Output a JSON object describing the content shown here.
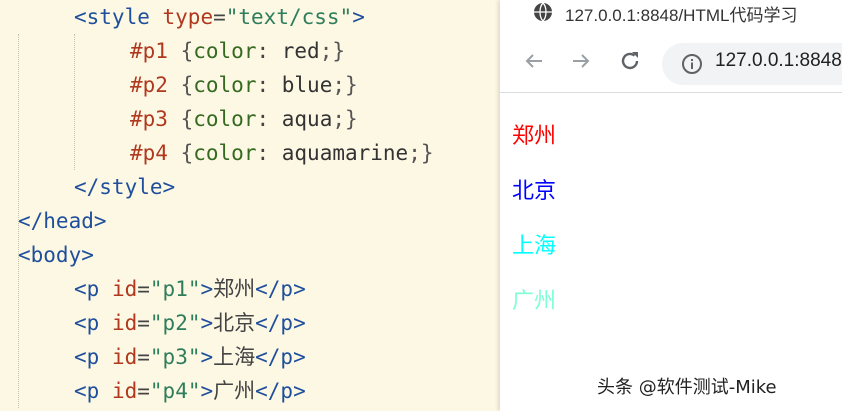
{
  "editor": {
    "lines": [
      {
        "parts": [
          [
            "tag",
            "<style"
          ],
          [
            "txt",
            " "
          ],
          [
            "attr",
            "type"
          ],
          [
            "txt",
            "="
          ],
          [
            "str",
            "\"text/css\""
          ],
          [
            "tag",
            ">"
          ]
        ]
      },
      {
        "parts": [
          [
            "sel",
            "#p1"
          ],
          [
            "txt",
            " "
          ],
          [
            "brace",
            "{"
          ],
          [
            "prop",
            "color"
          ],
          [
            "txt",
            ": "
          ],
          [
            "val",
            "red"
          ],
          [
            "brace",
            ";}"
          ]
        ]
      },
      {
        "parts": [
          [
            "sel",
            "#p2"
          ],
          [
            "txt",
            " "
          ],
          [
            "brace",
            "{"
          ],
          [
            "prop",
            "color"
          ],
          [
            "txt",
            ": "
          ],
          [
            "val",
            "blue"
          ],
          [
            "brace",
            ";}"
          ]
        ]
      },
      {
        "parts": [
          [
            "sel",
            "#p3"
          ],
          [
            "txt",
            " "
          ],
          [
            "brace",
            "{"
          ],
          [
            "prop",
            "color"
          ],
          [
            "txt",
            ": "
          ],
          [
            "val",
            "aqua"
          ],
          [
            "brace",
            ";}"
          ]
        ]
      },
      {
        "parts": [
          [
            "sel",
            "#p4"
          ],
          [
            "txt",
            " "
          ],
          [
            "brace",
            "{"
          ],
          [
            "prop",
            "color"
          ],
          [
            "txt",
            ": "
          ],
          [
            "val",
            "aquamarine"
          ],
          [
            "brace",
            ";}"
          ]
        ]
      },
      {
        "parts": [
          [
            "tag",
            "</style>"
          ]
        ]
      },
      {
        "parts": [
          [
            "tag",
            "</head>"
          ]
        ]
      },
      {
        "parts": [
          [
            "tag",
            "<body>"
          ]
        ]
      },
      {
        "parts": [
          [
            "tag",
            "<p"
          ],
          [
            "txt",
            " "
          ],
          [
            "attr",
            "id"
          ],
          [
            "txt",
            "="
          ],
          [
            "str",
            "\"p1\""
          ],
          [
            "tag",
            ">"
          ],
          [
            "txt",
            "郑州"
          ],
          [
            "tag",
            "</p>"
          ]
        ]
      },
      {
        "parts": [
          [
            "tag",
            "<p"
          ],
          [
            "txt",
            " "
          ],
          [
            "attr",
            "id"
          ],
          [
            "txt",
            "="
          ],
          [
            "str",
            "\"p2\""
          ],
          [
            "tag",
            ">"
          ],
          [
            "txt",
            "北京"
          ],
          [
            "tag",
            "</p>"
          ]
        ]
      },
      {
        "parts": [
          [
            "tag",
            "<p"
          ],
          [
            "txt",
            " "
          ],
          [
            "attr",
            "id"
          ],
          [
            "txt",
            "="
          ],
          [
            "str",
            "\"p3\""
          ],
          [
            "tag",
            ">"
          ],
          [
            "txt",
            "上海"
          ],
          [
            "tag",
            "</p>"
          ]
        ]
      },
      {
        "parts": [
          [
            "tag",
            "<p"
          ],
          [
            "txt",
            " "
          ],
          [
            "attr",
            "id"
          ],
          [
            "txt",
            "="
          ],
          [
            "str",
            "\"p4\""
          ],
          [
            "tag",
            ">"
          ],
          [
            "txt",
            "广州"
          ],
          [
            "tag",
            "</p>"
          ]
        ]
      }
    ]
  },
  "browser": {
    "tab_title": "127.0.0.1:8848/HTML代码学习",
    "url": "127.0.0.1:8848",
    "icons": {
      "tab": "globe-icon",
      "back": "back-arrow-icon",
      "forward": "forward-arrow-icon",
      "reload": "reload-icon",
      "site": "info-icon"
    },
    "paragraphs": [
      {
        "text": "郑州",
        "color": "#ff0000"
      },
      {
        "text": "北京",
        "color": "#0000ff"
      },
      {
        "text": "上海",
        "color": "#00ffff"
      },
      {
        "text": "广州",
        "color": "#7fffd4"
      }
    ]
  },
  "watermark": "头条 @软件测试-Mike"
}
